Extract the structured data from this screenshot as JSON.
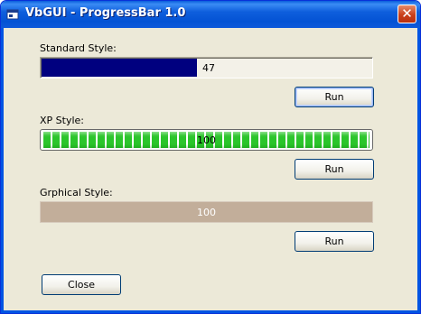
{
  "window": {
    "title": "VbGUI - ProgressBar 1.0",
    "titlebar_color": "#0a5ddc",
    "close_glyph": "✕",
    "app_icon": "window-app-icon"
  },
  "standard": {
    "label": "Standard Style:",
    "value_text": "47",
    "progress": 0.47,
    "color": "#00007f",
    "run_label": "Run"
  },
  "xp": {
    "label": "XP Style:",
    "value_text": "100",
    "progress": 1.0,
    "color": "#2bc52b",
    "run_label": "Run"
  },
  "graphical": {
    "label": "Grphical Style:",
    "value_text": "100",
    "progress": 1.0,
    "color": "#c5b3a1",
    "run_label": "Run"
  },
  "footer": {
    "close_label": "Close"
  }
}
